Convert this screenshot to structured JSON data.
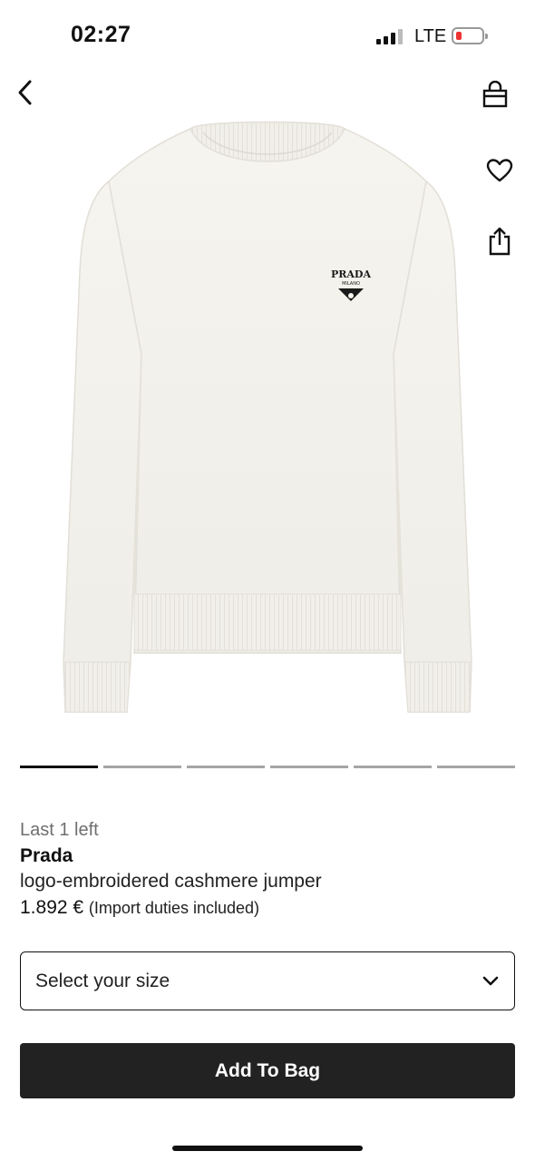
{
  "status_bar": {
    "time": "02:27",
    "network": "LTE",
    "battery_color": "#e33333"
  },
  "nav": {
    "back_icon": "chevron-left-icon",
    "bag_icon": "shopping-bag-icon",
    "wishlist_icon": "heart-icon",
    "share_icon": "share-icon"
  },
  "product_image": {
    "logo_text_main": "PRADA",
    "logo_text_sub": "MILANO"
  },
  "carousel": {
    "total": 6,
    "active_index": 0
  },
  "product": {
    "stock_note": "Last 1 left",
    "brand": "Prada",
    "name": "logo-embroidered cashmere jumper",
    "price": "1.892 €",
    "price_note": "(Import duties included)"
  },
  "size_select": {
    "placeholder": "Select your size",
    "icon": "chevron-down-icon"
  },
  "add_to_bag": {
    "label": "Add To Bag"
  }
}
